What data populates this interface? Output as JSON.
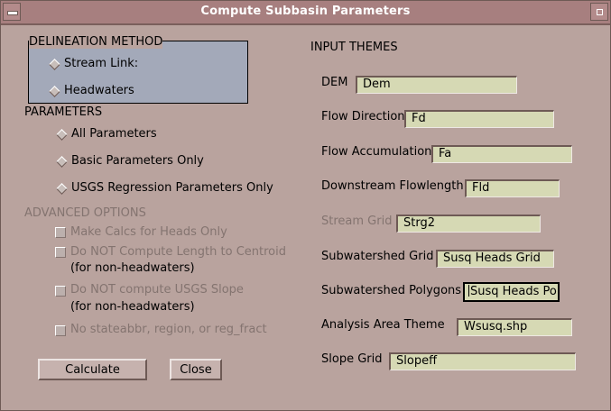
{
  "window": {
    "title": "Compute Subbasin Parameters"
  },
  "delineation": {
    "heading": "DELINEATION METHOD",
    "options": [
      {
        "label": "Stream Link:"
      },
      {
        "label": "Headwaters"
      }
    ]
  },
  "parameters": {
    "heading": "PARAMETERS",
    "options": [
      {
        "label": "All Parameters"
      },
      {
        "label": "Basic Parameters Only"
      },
      {
        "label": "USGS Regression Parameters Only"
      }
    ]
  },
  "advanced": {
    "heading": "ADVANCED OPTIONS",
    "options": [
      {
        "label": "Make Calcs for Heads Only"
      },
      {
        "label": "Do NOT Compute Length to Centroid",
        "sub": "(for non-headwaters)"
      },
      {
        "label": "Do NOT compute USGS Slope",
        "sub": "(for non-headwaters)"
      },
      {
        "label": "No stateabbr, region, or reg_fract"
      }
    ]
  },
  "input_themes": {
    "heading": "INPUT THEMES",
    "fields": [
      {
        "label": "DEM",
        "value": "Dem"
      },
      {
        "label": "Flow Direction",
        "value": "Fd"
      },
      {
        "label": "Flow Accumulation",
        "value": "Fa"
      },
      {
        "label": "Downstream Flowlength",
        "value": "Fld"
      },
      {
        "label": "Stream Grid",
        "value": "Strg2"
      },
      {
        "label": "Subwatershed Grid",
        "value": "Susq Heads Grid"
      },
      {
        "label": "Subwatershed Polygons",
        "value": "Susq Heads Po"
      },
      {
        "label": "Analysis Area Theme",
        "value": "Wsusq.shp"
      },
      {
        "label": "Slope Grid",
        "value": "Slopeff"
      }
    ]
  },
  "buttons": {
    "calculate": "Calculate",
    "close": "Close"
  }
}
